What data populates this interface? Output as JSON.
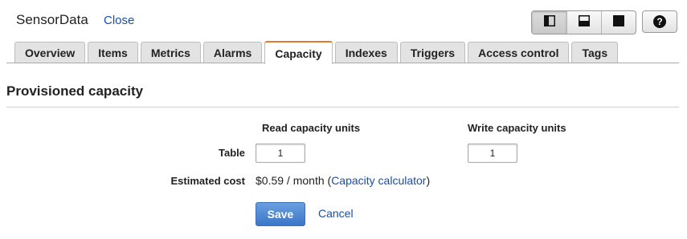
{
  "header": {
    "table_name": "SensorData",
    "close_label": "Close"
  },
  "view_toggle": {
    "buttons": [
      {
        "icon": "split-left-panel-icon",
        "active": true
      },
      {
        "icon": "split-bottom-panel-icon",
        "active": false
      },
      {
        "icon": "full-panel-icon",
        "active": false
      }
    ],
    "help_icon": "help-icon",
    "help_glyph": "?"
  },
  "tabs": [
    {
      "label": "Overview"
    },
    {
      "label": "Items"
    },
    {
      "label": "Metrics"
    },
    {
      "label": "Alarms"
    },
    {
      "label": "Capacity",
      "active": true
    },
    {
      "label": "Indexes"
    },
    {
      "label": "Triggers"
    },
    {
      "label": "Access control"
    },
    {
      "label": "Tags"
    }
  ],
  "section": {
    "title": "Provisioned capacity"
  },
  "capacity": {
    "read_header": "Read capacity units",
    "write_header": "Write capacity units",
    "table_label": "Table",
    "read_value": "1",
    "write_value": "1",
    "cost_label": "Estimated cost",
    "cost_value": "$0.59 / month",
    "calc_open": "(",
    "calc_link": "Capacity calculator",
    "calc_close": ")"
  },
  "actions": {
    "save_label": "Save",
    "cancel_label": "Cancel"
  },
  "colors": {
    "accent_tab": "#e07a2e",
    "link": "#1a4ea8",
    "primary_button": "#3a77c9"
  }
}
